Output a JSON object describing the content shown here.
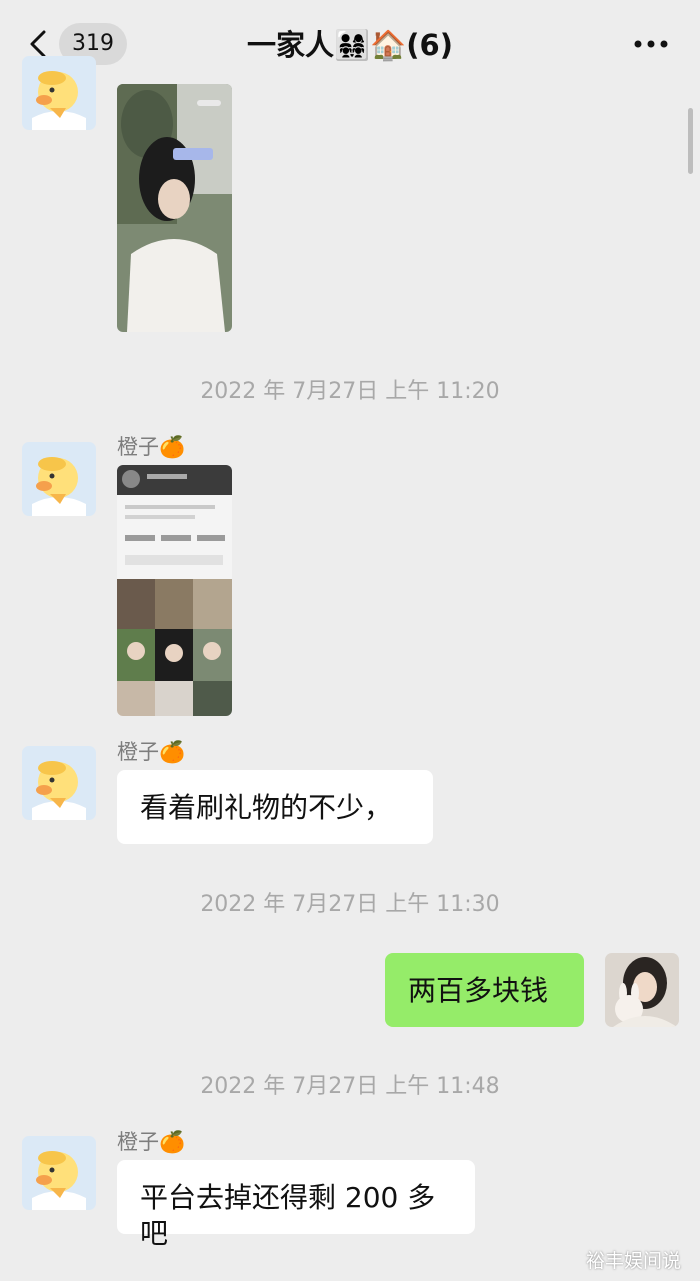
{
  "header": {
    "unread_count": "319",
    "title": "一家人👨‍👩‍👧‍👧🏠(6)"
  },
  "messages": {
    "ts1": "2022 年 7月27日  上午 11:20",
    "ts2": "2022 年 7月27日  上午 11:30",
    "ts3": "2022 年 7月27日  上午 11:48",
    "sender_2": "橙子🍊",
    "sender_3": "橙子🍊",
    "sender_5": "橙子🍊",
    "msg_3": "看着刷礼物的不少，",
    "msg_4": "两百多块钱",
    "msg_5": "平台去掉还得剩 200 多吧"
  },
  "watermark": "裕丰娱间说",
  "colors": {
    "chat_bg": "#ededed",
    "own_bubble": "#95ec69",
    "other_bubble": "#ffffff",
    "timestamp_text": "#a8a8a8",
    "name_text": "#7d7d7d"
  },
  "icons": [
    "chevron-left-icon",
    "more-dots-icon",
    "duck-avatar",
    "user-photo-avatar"
  ]
}
